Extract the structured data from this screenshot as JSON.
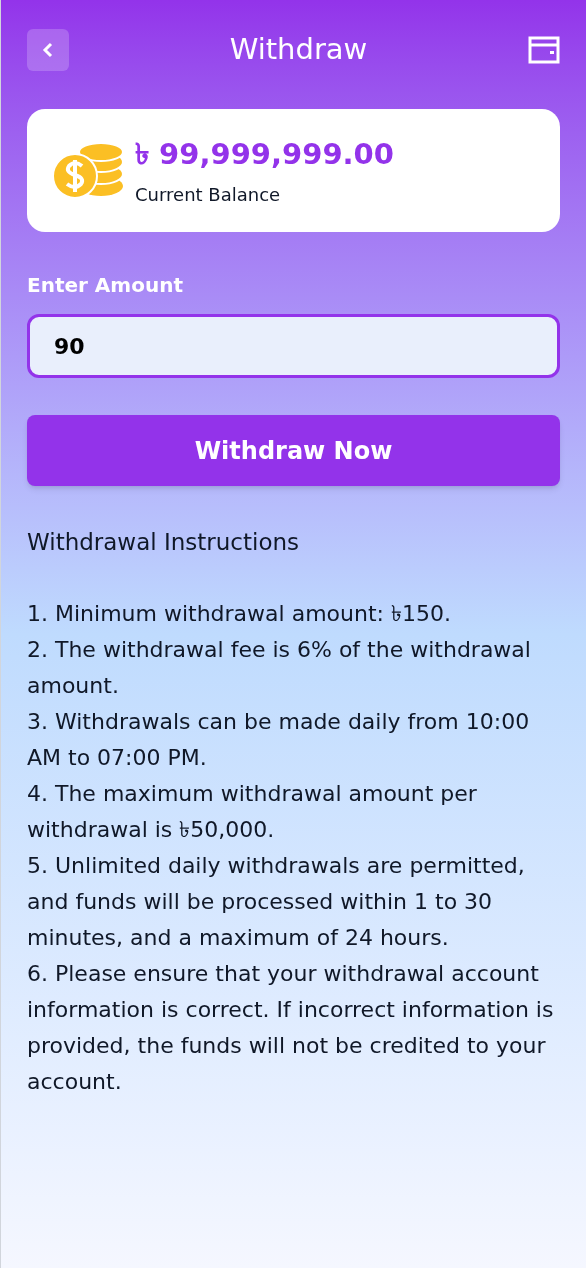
{
  "header": {
    "title": "Withdraw"
  },
  "balance": {
    "amount": "৳ 99,999,999.00",
    "label": "Current Balance"
  },
  "amount_field": {
    "label": "Enter Amount",
    "value": "90"
  },
  "submit_button": "Withdraw Now",
  "instructions": {
    "title": "Withdrawal Instructions",
    "items": [
      "1. Minimum withdrawal amount: ৳150.",
      "2. The withdrawal fee is 6% of the withdrawal amount.",
      "3. Withdrawals can be made daily from 10:00 AM to 07:00 PM.",
      "4. The maximum withdrawal amount per withdrawal is ৳50,000.",
      "5. Unlimited daily withdrawals are permitted, and funds will be processed within 1 to 30 minutes, and a maximum of 24 hours.",
      "6. Please ensure that your withdrawal account information is correct. If incorrect information is provided, the funds will not be credited to your account."
    ]
  }
}
